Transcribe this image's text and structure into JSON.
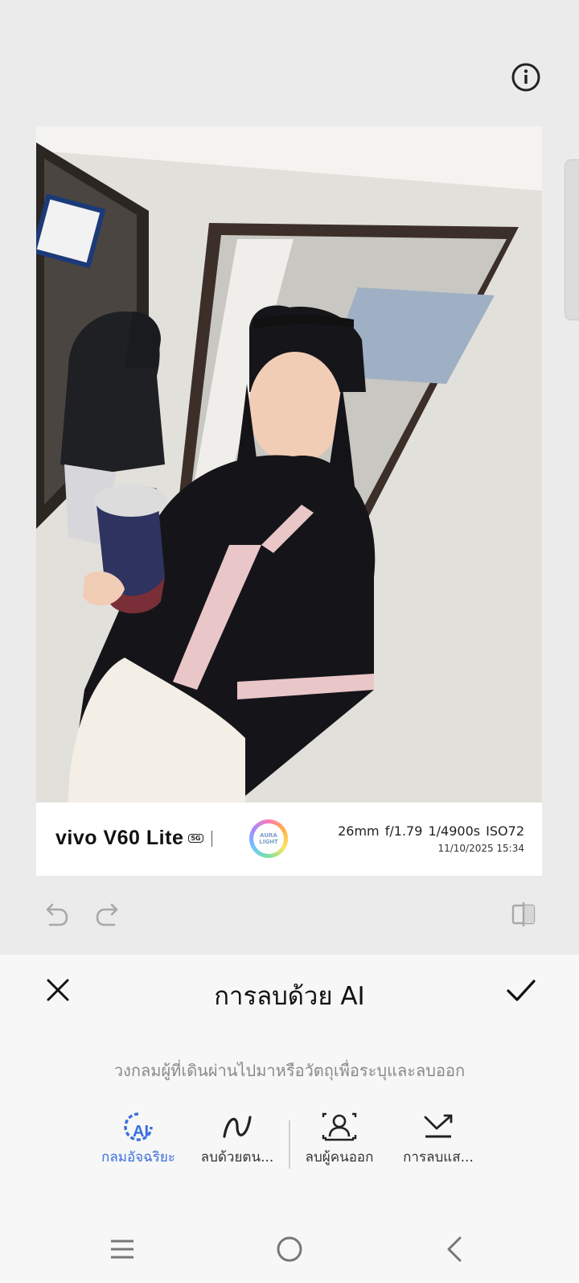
{
  "header": {
    "info_icon": "info-circle-icon"
  },
  "photo": {
    "description_icon": "photo",
    "watermark": {
      "brand": "vivo V60 Lite",
      "network_badge": "5G",
      "aura_line1": "AURA",
      "aura_line2": "LIGHT",
      "specs": "26mm  f/1.79  1/4900s  ISO72",
      "datetime": "11/10/2025 15:34"
    }
  },
  "edit_toolbar": {
    "undo_icon": "undo-icon",
    "redo_icon": "redo-icon",
    "compare_icon": "compare-icon"
  },
  "sheet": {
    "title": "การลบด้วย AI",
    "hint": "วงกลมผู้ที่เดินผ่านไปมาหรือวัตถุเพื่อระบุและลบออก",
    "modes": [
      {
        "label": "กลมอัจฉริยะ",
        "icon": "ai-circle-icon",
        "active": true
      },
      {
        "label": "ลบด้วยตน...",
        "icon": "brush-stroke-icon",
        "active": false
      },
      {
        "label": "ลบผู้คนออก",
        "icon": "people-remove-icon",
        "active": false
      },
      {
        "label": "การลบแส...",
        "icon": "reflection-remove-icon",
        "active": false
      }
    ]
  },
  "colors": {
    "accent": "#3a6fe0",
    "sheet_bg": "#f7f7f7",
    "page_bg": "#ebebeb"
  }
}
